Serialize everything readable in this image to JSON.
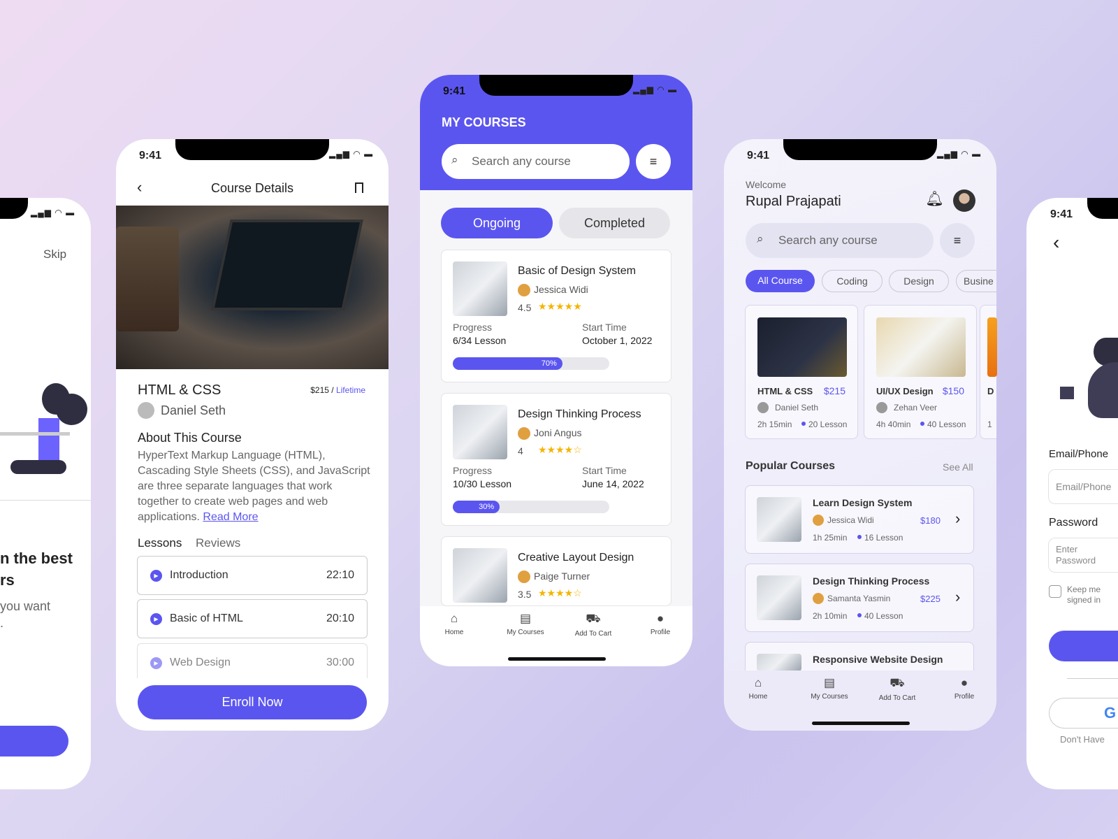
{
  "status_time": "9:41",
  "onboarding": {
    "skip": "Skip",
    "title_line1": "n the best",
    "title_line2": "rs",
    "desc_line1": "you want",
    "desc_line2": "."
  },
  "details": {
    "title": "Course Details",
    "course": "HTML & CSS",
    "price": "$215",
    "price_sep": " / ",
    "price_term": "Lifetime",
    "author": "Daniel Seth",
    "about_title": "About This Course",
    "about_text": "HyperText Markup Language (HTML), Cascading Style Sheets (CSS), and JavaScript are three separate languages that work together to create web pages and web applications.",
    "read_more": "Read More",
    "tabs": [
      "Lessons",
      "Reviews"
    ],
    "lessons": [
      {
        "name": "Introduction",
        "time": "22:10"
      },
      {
        "name": "Basic of HTML",
        "time": "20:10"
      },
      {
        "name": "Web Design",
        "time": "30:00"
      }
    ],
    "enroll": "Enroll Now"
  },
  "my_courses": {
    "title": "MY COURSES",
    "search_placeholder": "Search any course",
    "tabs": [
      "Ongoing",
      "Completed"
    ],
    "progress_label": "Progress",
    "start_label": "Start Time",
    "courses": [
      {
        "title": "Basic of Design System",
        "author": "Jessica Widi",
        "rating": "4.5",
        "stars": 4.5,
        "progress": "6/34 Lesson",
        "start": "October 1, 2022",
        "percent": 70,
        "percent_label": "70%"
      },
      {
        "title": "Design Thinking Process",
        "author": "Joni Angus",
        "rating": "4",
        "stars": 4,
        "progress": "10/30 Lesson",
        "start": "June 14, 2022",
        "percent": 30,
        "percent_label": "30%"
      },
      {
        "title": "Creative Layout Design",
        "author": "Paige Turner",
        "rating": "3.5",
        "stars": 3.5
      }
    ]
  },
  "nav": {
    "home": "Home",
    "my_courses": "My Courses",
    "cart": "Add To Cart",
    "profile": "Profile"
  },
  "home": {
    "welcome": "Welcome",
    "user": "Rupal Prajapati",
    "search_placeholder": "Search any course",
    "chips": [
      "All Course",
      "Coding",
      "Design",
      "Busine"
    ],
    "featured": [
      {
        "title": "HTML & CSS",
        "price": "$215",
        "author": "Daniel Seth",
        "duration": "2h 15min",
        "lessons": "20 Lesson"
      },
      {
        "title": "UI/UX Design",
        "price": "$150",
        "author": "Zehan Veer",
        "duration": "4h 40min",
        "lessons": "40 Lesson"
      },
      {
        "title": "D",
        "duration": "1"
      }
    ],
    "popular_title": "Popular Courses",
    "see_all": "See All",
    "popular": [
      {
        "title": "Learn Design System",
        "author": "Jessica Widi",
        "price": "$180",
        "duration": "1h 25min",
        "lessons": "16 Lesson"
      },
      {
        "title": "Design Thinking Process",
        "author": "Samanta Yasmin",
        "price": "$225",
        "duration": "2h 10min",
        "lessons": "40 Lesson"
      },
      {
        "title": "Responsive Website Design"
      }
    ]
  },
  "login": {
    "email_label": "Email/Phone",
    "email_placeholder": "Email/Phone",
    "password_label": "Password",
    "password_placeholder": "Enter Password",
    "keep": "Keep me signed in",
    "dont_have": "Don't Have"
  },
  "colors": {
    "accent": "#5b55f0",
    "star": "#f5b400"
  }
}
